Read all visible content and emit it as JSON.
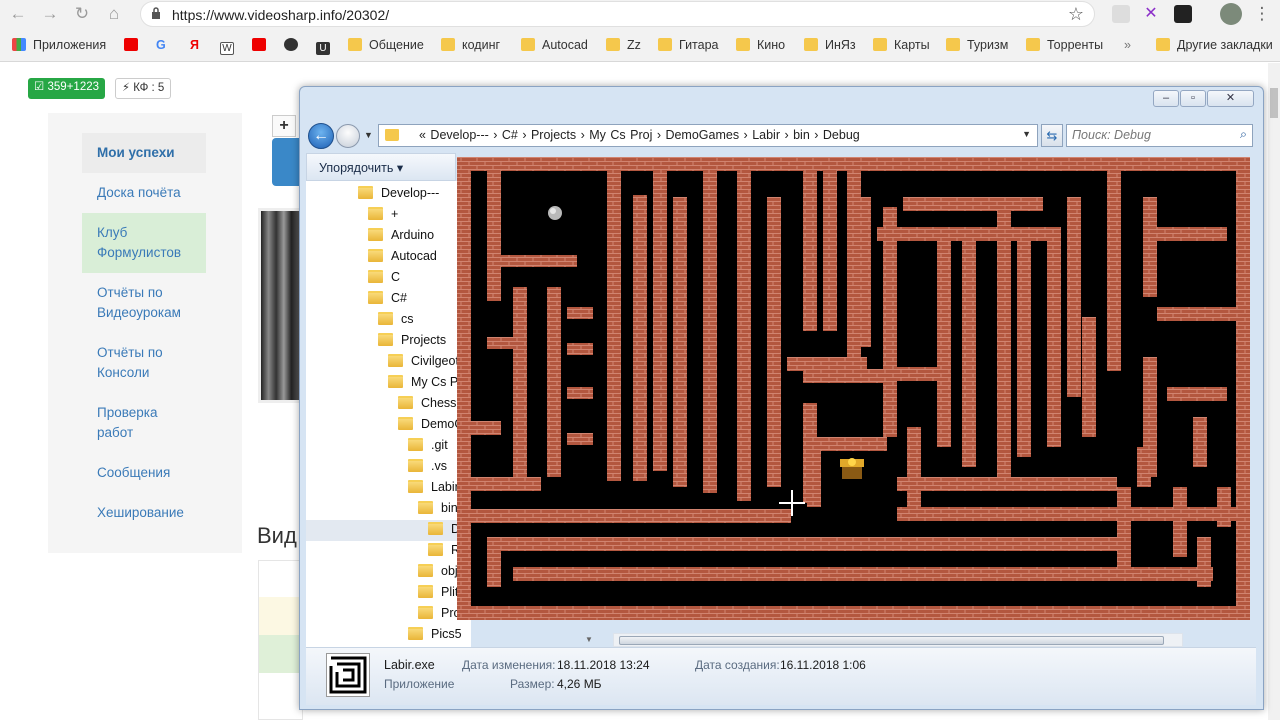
{
  "browser": {
    "url": "https://www.videosharp.info/20302/",
    "bookmarks": [
      "Приложения",
      "Общение",
      "кодинг",
      "Autocad",
      "Zz",
      "Гитара",
      "Кино",
      "ИнЯз",
      "Карты",
      "Туризм",
      "Торренты",
      "»",
      "Другие закладки"
    ]
  },
  "site": {
    "badge_points": "359+1223",
    "badge_kf": "КФ : 5",
    "sidebar": [
      "Мои успехи",
      "Доска почёта",
      "Клуб Формулистов",
      "Отчёты по Видеоурокам",
      "Отчёты по Консоли",
      "Проверка работ",
      "Сообщения",
      "Хеширование"
    ],
    "heading": "Вид",
    "plus": "+"
  },
  "explorer": {
    "breadcrumb": "«  Develop---  ›  C#  ›  Projects  ›  My Cs Proj  ›  DemoGames  ›  Labir  ›  bin  ›  Debug",
    "search_placeholder": "Поиск: Debug",
    "organize": "Упорядочить ▾",
    "tree": [
      {
        "label": "Develop---",
        "level": 0
      },
      {
        "label": "+",
        "level": 1
      },
      {
        "label": "Arduino",
        "level": 1
      },
      {
        "label": "Autocad",
        "level": 1
      },
      {
        "label": "C",
        "level": 1
      },
      {
        "label": "C#",
        "level": 1
      },
      {
        "label": "cs",
        "level": 2
      },
      {
        "label": "Projects",
        "level": 2
      },
      {
        "label": "Civilgeot",
        "level": 3
      },
      {
        "label": "My Cs Pr",
        "level": 3
      },
      {
        "label": "Chess",
        "level": 4
      },
      {
        "label": "DemoG",
        "level": 4
      },
      {
        "label": ".git",
        "level": 5
      },
      {
        "label": ".vs",
        "level": 5
      },
      {
        "label": "Labir",
        "level": 5
      },
      {
        "label": "bin",
        "level": 6
      },
      {
        "label": "D",
        "level": 7
      },
      {
        "label": "R",
        "level": 7
      },
      {
        "label": "obj",
        "level": 6
      },
      {
        "label": "Plit",
        "level": 6
      },
      {
        "label": "Prog",
        "level": 6
      },
      {
        "label": "Pics5",
        "level": 5
      }
    ],
    "status": {
      "filename": "Labir.exe",
      "type": "Приложение",
      "modified_label": "Дата изменения:",
      "modified_value": "18.11.2018 13:24",
      "size_label": "Размер:",
      "size_value": "4,26 МБ",
      "created_label": "Дата создания:",
      "created_value": "16.11.2018 1:06"
    }
  },
  "colors": {
    "brick": "#b3573f",
    "mortar": "#d9907c",
    "maze_bg": "#000000",
    "link": "#3a7ab8",
    "badge_green": "#27a745"
  }
}
